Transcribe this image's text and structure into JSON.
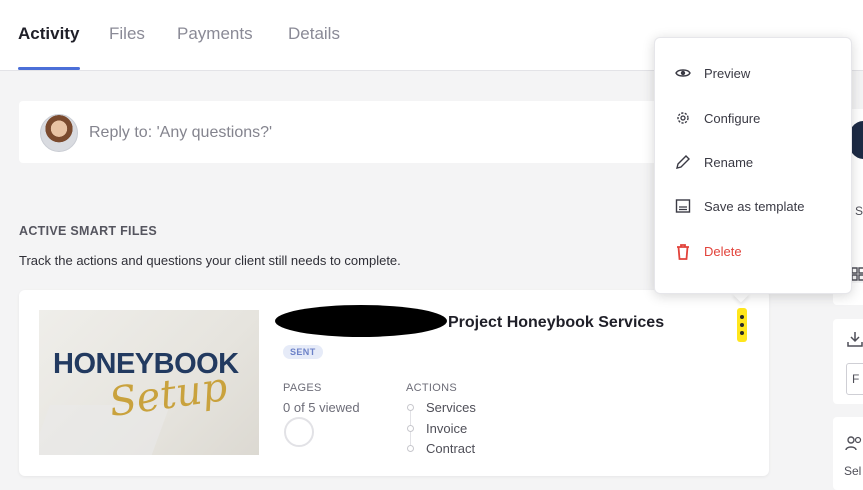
{
  "tabs": [
    {
      "label": "Activity",
      "active": true
    },
    {
      "label": "Files",
      "active": false
    },
    {
      "label": "Payments",
      "active": false
    },
    {
      "label": "Details",
      "active": false
    }
  ],
  "reply": {
    "placeholder": "Reply to: 'Any questions?'"
  },
  "section": {
    "title": "ACTIVE SMART FILES",
    "description": "Track the actions and questions your client still needs to complete."
  },
  "smart_file": {
    "thumbnail_title": "HONEYBOOK",
    "thumbnail_script": "Setup",
    "title": "Project Honeybook Services",
    "status": "SENT",
    "pages_label": "PAGES",
    "pages_value": "0 of 5 viewed",
    "actions_label": "ACTIONS",
    "actions": [
      "Services",
      "Invoice",
      "Contract"
    ]
  },
  "menu": {
    "items": [
      {
        "label": "Preview",
        "icon": "eye-icon"
      },
      {
        "label": "Configure",
        "icon": "gear-icon"
      },
      {
        "label": "Rename",
        "icon": "pencil-icon"
      },
      {
        "label": "Save as template",
        "icon": "template-icon"
      },
      {
        "label": "Delete",
        "icon": "trash-icon"
      }
    ]
  },
  "sidebar": {
    "fragment_1": "S",
    "fragment_2": "F",
    "fragment_3": "Sel"
  },
  "colors": {
    "accent": "#4b6fd8",
    "danger": "#e2433b",
    "highlight": "#ffef22"
  }
}
